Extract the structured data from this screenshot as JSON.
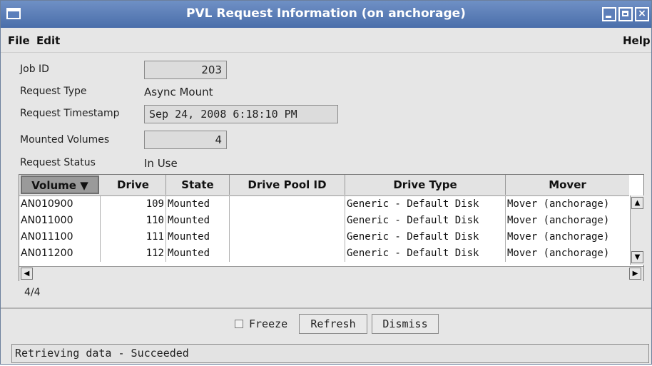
{
  "window": {
    "title": "PVL Request Information (on anchorage)"
  },
  "menubar": {
    "file": "File",
    "edit": "Edit",
    "help": "Help"
  },
  "form": {
    "job_id": {
      "label": "Job ID",
      "value": "203"
    },
    "request_type": {
      "label": "Request Type",
      "value": "Async Mount"
    },
    "request_timestamp": {
      "label": "Request Timestamp",
      "value": "Sep 24, 2008 6:18:10 PM"
    },
    "mounted_volumes": {
      "label": "Mounted Volumes",
      "value": "4"
    },
    "request_status": {
      "label": "Request Status",
      "value": "In Use"
    }
  },
  "table": {
    "columns": [
      "Volume ▼",
      "Drive",
      "State",
      "Drive Pool ID",
      "Drive Type",
      "Mover"
    ],
    "rows": [
      [
        "AN010900",
        "109",
        "Mounted",
        "",
        "Generic - Default Disk",
        "Mover (anchorage)"
      ],
      [
        "AN011000",
        "110",
        "Mounted",
        "",
        "Generic - Default Disk",
        "Mover (anchorage)"
      ],
      [
        "AN011100",
        "111",
        "Mounted",
        "",
        "Generic - Default Disk",
        "Mover (anchorage)"
      ],
      [
        "AN011200",
        "112",
        "Mounted",
        "",
        "Generic - Default Disk",
        "Mover (anchorage)"
      ]
    ],
    "count": "4/4"
  },
  "buttons": {
    "freeze": "Freeze",
    "refresh": "Refresh",
    "dismiss": "Dismiss"
  },
  "status": {
    "text": "Retrieving data - Succeeded"
  },
  "colors": {
    "titlebar": "#5a7db8",
    "background": "#e6e6e6"
  }
}
